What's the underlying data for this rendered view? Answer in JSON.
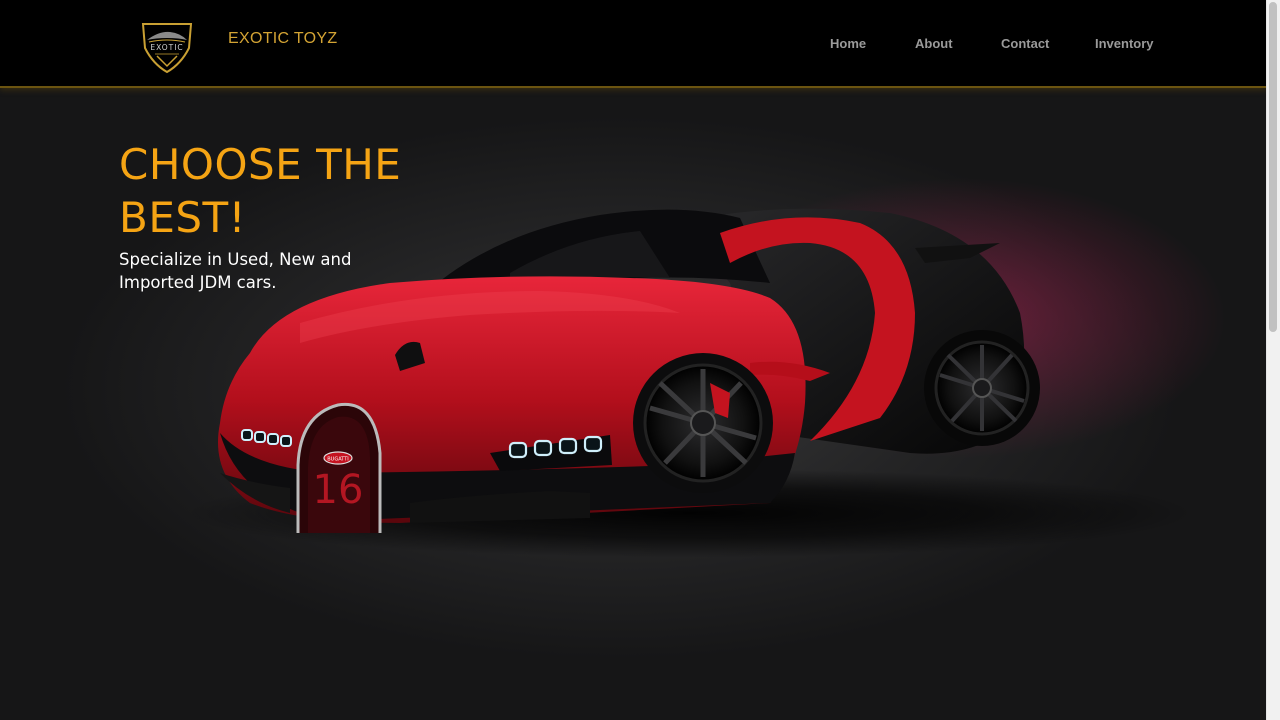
{
  "header": {
    "logo_text": "EXOTIC",
    "brand": "EXOTIC TOYZ",
    "nav": [
      {
        "label": "Home"
      },
      {
        "label": "About"
      },
      {
        "label": "Contact"
      },
      {
        "label": "Inventory"
      }
    ]
  },
  "hero": {
    "headline": "CHOOSE THE BEST!",
    "subtext": "Specialize in Used, New and Imported JDM cars.",
    "car_badge": "BUGATTI",
    "car_number": "16"
  },
  "colors": {
    "accent": "#f5a414",
    "brand_gold": "#d4a434",
    "nav_text": "#9a9a9a",
    "car_red": "#c4131f"
  },
  "icons": {
    "logo": "shield-car-logo-icon",
    "hero_image": "red-black-hypercar-image"
  }
}
